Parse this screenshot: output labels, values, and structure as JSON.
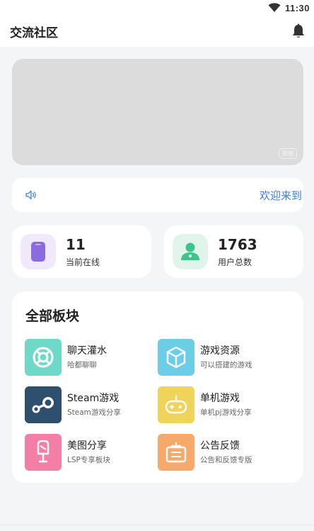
{
  "status_bar": {
    "time": "11:30"
  },
  "header": {
    "title": "交流社区",
    "bell_icon": "bell-icon"
  },
  "banner": {
    "tag": "链接",
    "background": "#dcdcdc"
  },
  "notice": {
    "text": "欢迎来到",
    "color": "#3b7ed8",
    "icon": "speaker-icon"
  },
  "stats": {
    "online": {
      "value": "11",
      "label": "当前在线",
      "icon": "phone-icon",
      "accent": "#8b6be0"
    },
    "users": {
      "value": "1763",
      "label": "用户总数",
      "icon": "user-icon",
      "accent": "#3cc58a"
    }
  },
  "sections": {
    "title": "全部板块",
    "boards": [
      {
        "name": "聊天灌水",
        "desc": "哈都聊聊",
        "icon": "lifebuoy-icon",
        "color": "#6ed9c9"
      },
      {
        "name": "游戏资源",
        "desc": "可以搭建的游戏",
        "icon": "cube-icon",
        "color": "#6ccde6"
      },
      {
        "name": "Steam游戏",
        "desc": "Steam游戏分享",
        "icon": "steam-icon",
        "color": "#2f4f6e"
      },
      {
        "name": "单机游戏",
        "desc": "单机pj游戏分享",
        "icon": "gamepad-icon",
        "color": "#f0d35a"
      },
      {
        "name": "美图分享",
        "desc": "LSP专享板块",
        "icon": "popsicle-icon",
        "color": "#f47fa6"
      },
      {
        "name": "公告反馈",
        "desc": "公告和反馈专版",
        "icon": "notice-board-icon",
        "color": "#f6a96b"
      }
    ]
  }
}
